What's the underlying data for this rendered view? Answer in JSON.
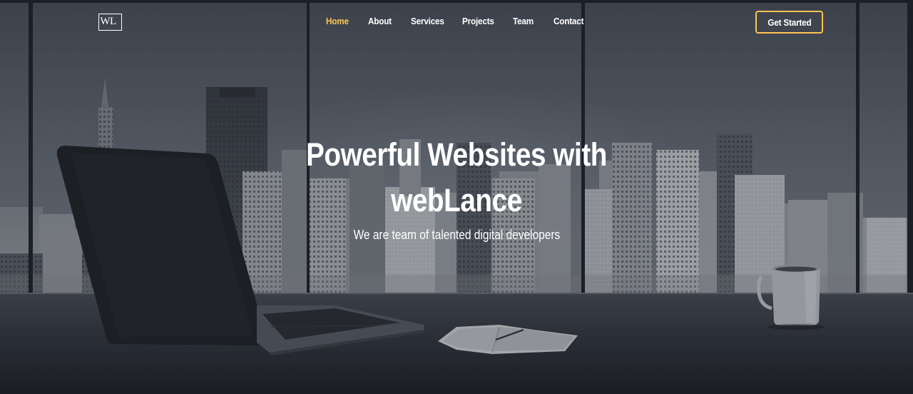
{
  "header": {
    "logo_text": "WL",
    "nav": [
      {
        "label": "Home",
        "active": true
      },
      {
        "label": "About",
        "active": false
      },
      {
        "label": "Services",
        "active": false
      },
      {
        "label": "Projects",
        "active": false
      },
      {
        "label": "Team",
        "active": false
      },
      {
        "label": "Contact",
        "active": false
      }
    ],
    "cta_label": "Get Started"
  },
  "hero": {
    "title_line1": "Powerful Websites with",
    "title_line2": "webLance",
    "subtitle": "We are team of talented digital developers"
  },
  "colors": {
    "accent": "#ffc451",
    "text": "#ffffff",
    "overlay": "#161a21"
  }
}
